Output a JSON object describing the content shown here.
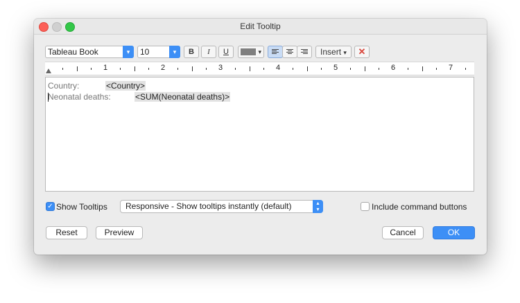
{
  "window": {
    "title": "Edit Tooltip"
  },
  "toolbar": {
    "font_family": "Tableau Book",
    "font_size": "10",
    "bold_label": "B",
    "italic_label": "I",
    "underline_label": "U",
    "insert_label": "Insert",
    "text_color": "#7f7f7f"
  },
  "ruler": {
    "labels": [
      "1",
      "2",
      "3",
      "4",
      "5",
      "6",
      "7"
    ]
  },
  "editor": {
    "lines": [
      {
        "label": "Country:",
        "field": "<Country>"
      },
      {
        "label": "Neonatal deaths:",
        "field": "<SUM(Neonatal deaths)>"
      }
    ]
  },
  "options": {
    "show_tooltips_label": "Show Tooltips",
    "show_tooltips_checked": true,
    "mode_value": "Responsive - Show tooltips instantly (default)",
    "include_command_label": "Include command buttons",
    "include_command_checked": false
  },
  "buttons": {
    "reset": "Reset",
    "preview": "Preview",
    "cancel": "Cancel",
    "ok": "OK"
  },
  "icons": {
    "checkmark": "✓",
    "dropdown": "▾",
    "updown_top": "▴",
    "updown_bottom": "▾",
    "clear": "✕"
  },
  "colors": {
    "accent": "#3d8ff6",
    "clear_icon": "#d9453b"
  }
}
